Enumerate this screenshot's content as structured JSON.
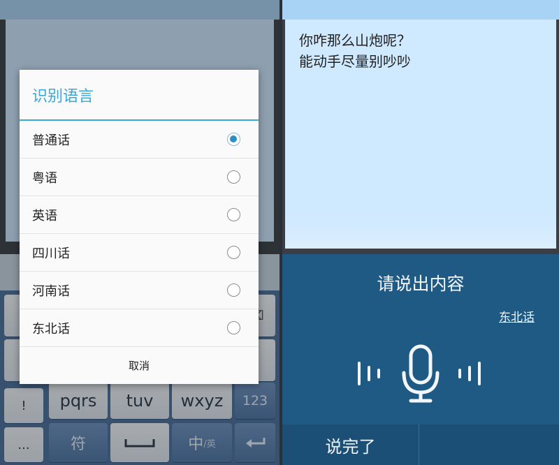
{
  "left": {
    "dialog": {
      "title": "识别语言",
      "options": [
        {
          "label": "普通话",
          "selected": true
        },
        {
          "label": "粤语",
          "selected": false
        },
        {
          "label": "英语",
          "selected": false
        },
        {
          "label": "四川话",
          "selected": false
        },
        {
          "label": "河南话",
          "selected": false
        },
        {
          "label": "东北话",
          "selected": false
        }
      ],
      "cancel_label": "取消"
    },
    "keyboard": {
      "row3": [
        "pqrs",
        "tuv",
        "wxyz",
        "123"
      ],
      "row4": {
        "symbols": "符",
        "lang": "中",
        "lang_sub": "/英"
      },
      "side_keys": [
        "!",
        "..."
      ]
    }
  },
  "right": {
    "note_lines": [
      "你咋那么山炮呢？",
      "能动手尽量别吵吵"
    ],
    "voice": {
      "prompt": "请说出内容",
      "dialect": "东北话",
      "done_label": "说完了"
    }
  },
  "colors": {
    "accent": "#36a9d8",
    "radio_selected": "#2a8fc8",
    "voice_bg": "#1f5a85",
    "note_bg": "#cfe9ff",
    "keyboard_bg": "#4b6f9c"
  }
}
